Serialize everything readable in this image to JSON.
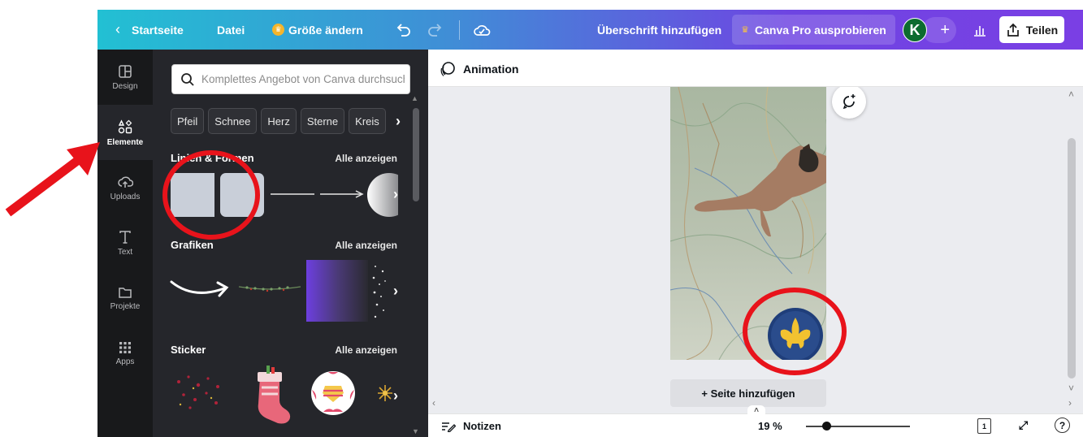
{
  "topbar": {
    "home_label": "Startseite",
    "file_label": "Datei",
    "resize_label": "Größe ändern",
    "heading_label": "Überschrift hinzufügen",
    "pro_label": "Canva Pro ausprobieren",
    "avatar_initial": "K",
    "share_label": "Teilen"
  },
  "rail": {
    "items": [
      {
        "label": "Design",
        "icon": "layout-icon"
      },
      {
        "label": "Elemente",
        "icon": "shapes-icon"
      },
      {
        "label": "Uploads",
        "icon": "cloud-upload-icon"
      },
      {
        "label": "Text",
        "icon": "text-icon"
      },
      {
        "label": "Projekte",
        "icon": "folder-icon"
      },
      {
        "label": "Apps",
        "icon": "grid-icon"
      }
    ],
    "active": "Elemente"
  },
  "panel": {
    "search_placeholder": "Komplettes Angebot von Canva durchsuchen",
    "chips": [
      "Pfeil",
      "Schnee",
      "Herz",
      "Sterne",
      "Kreis"
    ],
    "sections": [
      {
        "title": "Linien & Formen",
        "link": "Alle anzeigen"
      },
      {
        "title": "Grafiken",
        "link": "Alle anzeigen"
      },
      {
        "title": "Sticker",
        "link": "Alle anzeigen"
      }
    ]
  },
  "toolbar": {
    "animation_label": "Animation"
  },
  "canvas": {
    "add_page_label": "+ Seite hinzufügen"
  },
  "bottombar": {
    "notes_label": "Notizen",
    "zoom_label": "19 %",
    "zoom_level": 0.2,
    "page_count": "1"
  },
  "colors": {
    "accent_annotation": "#e8131b",
    "panel_bg": "#25262b",
    "rail_bg": "#18191b"
  }
}
